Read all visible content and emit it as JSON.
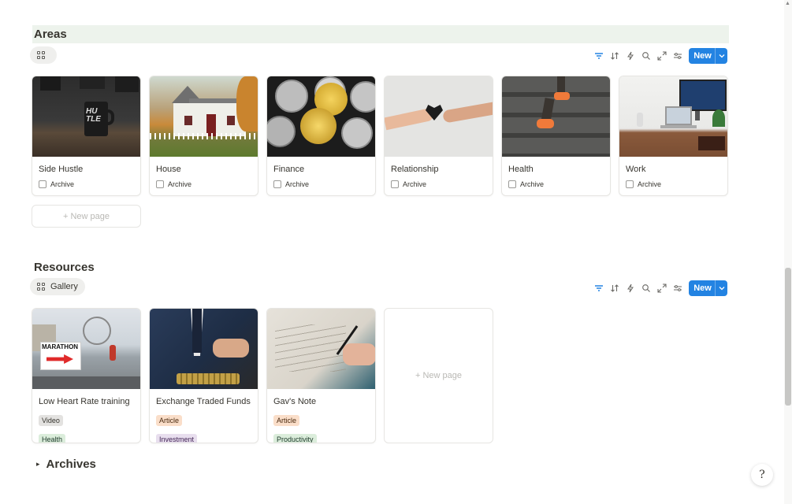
{
  "areas": {
    "title": "Areas",
    "view_tab_label": "",
    "new_button": "New",
    "new_page": "+ New page",
    "cards": [
      {
        "title": "Side Hustle",
        "prop": "Archive"
      },
      {
        "title": "House",
        "prop": "Archive"
      },
      {
        "title": "Finance",
        "prop": "Archive"
      },
      {
        "title": "Relationship",
        "prop": "Archive"
      },
      {
        "title": "Health",
        "prop": "Archive"
      },
      {
        "title": "Work",
        "prop": "Archive"
      }
    ]
  },
  "resources": {
    "title": "Resources",
    "view_tab_label": "Gallery",
    "new_button": "New",
    "new_page": "+ New page",
    "cards": [
      {
        "title": "Low Heart Rate training",
        "tag1": "Video",
        "tag2": "Health"
      },
      {
        "title": "Exchange Traded Funds",
        "tag1": "Article",
        "tag2": "Investment"
      },
      {
        "title": "Gav's Note",
        "tag1": "Article",
        "tag2": "Productivity"
      }
    ],
    "cover_text": "MARATHON"
  },
  "archives": {
    "title": "Archives",
    "toggle": "▸"
  },
  "help": {
    "label": "?"
  },
  "colors": {
    "accent": "#2383e2",
    "tag_video": "#e3e2e0",
    "tag_article": "#fadec9",
    "tag_health": "#dbeddb",
    "tag_investment": "#e8deee",
    "tag_productivity": "#dbeddb",
    "areas_header_bg": "#edf3ec"
  }
}
